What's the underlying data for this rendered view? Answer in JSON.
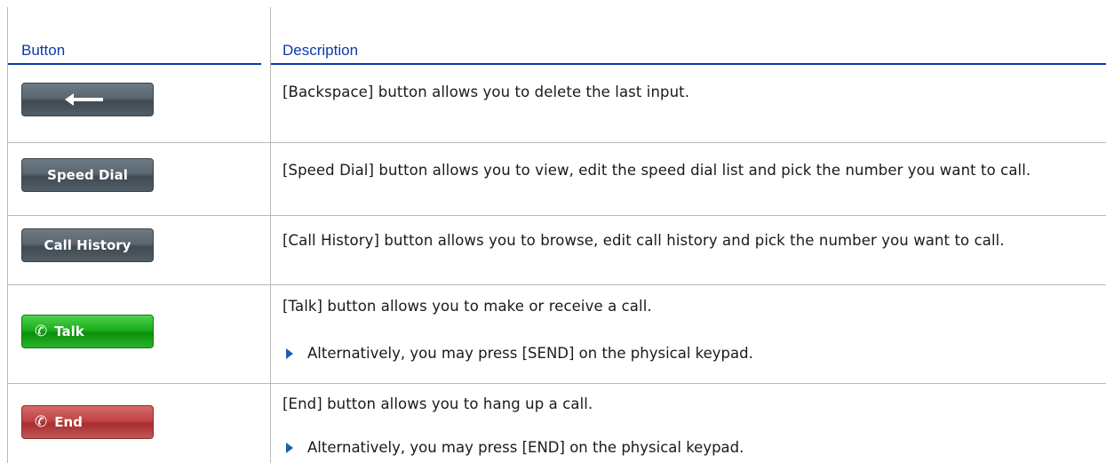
{
  "table": {
    "headers": {
      "button": "Button",
      "description": "Description"
    },
    "rows": [
      {
        "button": {
          "icon": "backspace-arrow-icon",
          "label": "",
          "style": "dark"
        },
        "description": "[Backspace] button allows you to delete the last input.",
        "bullet": ""
      },
      {
        "button": {
          "icon": "",
          "label": "Speed Dial",
          "style": "dark"
        },
        "description": "[Speed Dial] button allows you to view, edit the speed dial list and pick the number you want to call.",
        "bullet": ""
      },
      {
        "button": {
          "icon": "",
          "label": "Call History",
          "style": "dark"
        },
        "description": "[Call History] button allows you to browse, edit call history and pick the number you want to call.",
        "bullet": ""
      },
      {
        "button": {
          "icon": "phone-icon",
          "label": "Talk",
          "style": "green"
        },
        "description": "[Talk] button allows you to make or receive a call.",
        "bullet": "Alternatively, you may press [SEND] on the physical keypad."
      },
      {
        "button": {
          "icon": "phone-icon",
          "label": "End",
          "style": "red"
        },
        "description": "[End] button allows you to hang up a call.",
        "bullet": "Alternatively, you may press [END] on the physical keypad."
      }
    ]
  },
  "colors": {
    "header_text": "#0a3aa8",
    "bullet": "#1a5fb4",
    "grid": "#b9b9b9"
  }
}
